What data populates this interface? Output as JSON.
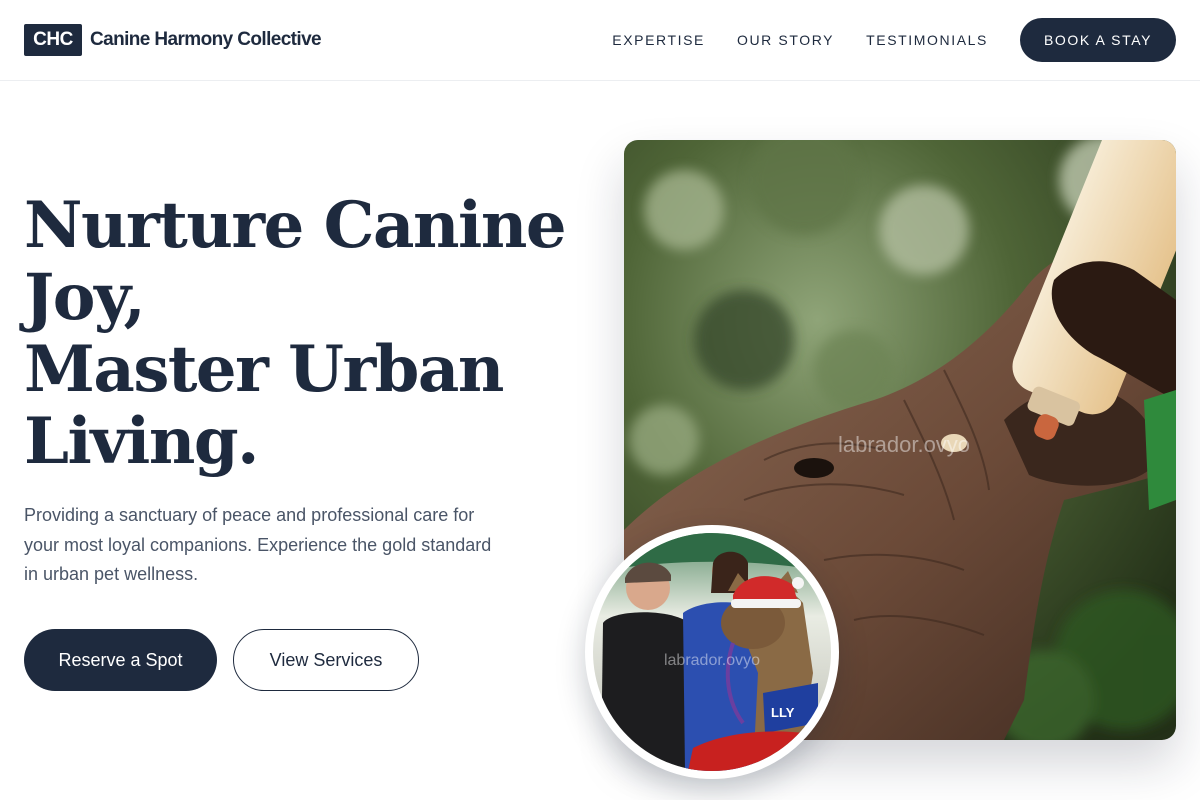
{
  "brand": {
    "badge": "CHC",
    "name": "Canine Harmony Collective"
  },
  "nav": {
    "links": [
      "EXPERTISE",
      "OUR STORY",
      "TESTIMONIALS"
    ],
    "cta": "BOOK A STAY"
  },
  "hero": {
    "title_lines": [
      "Nurture Canine",
      "Joy,",
      "Master Urban",
      "Living."
    ],
    "subtitle": "Providing a sanctuary of peace and professional care for your most loyal companions. Experience the gold standard in urban pet wellness.",
    "primary_button": "Reserve a Spot",
    "secondary_button": "View Services"
  },
  "images": {
    "main_watermark": "labrador.ovyo",
    "inset_watermark": "labrador.ovyo",
    "inset_sign_text": "LLY"
  },
  "colors": {
    "navy": "#1e2a3e",
    "body_text": "#4a5567",
    "divider": "#eceef1",
    "background": "#ffffff"
  }
}
